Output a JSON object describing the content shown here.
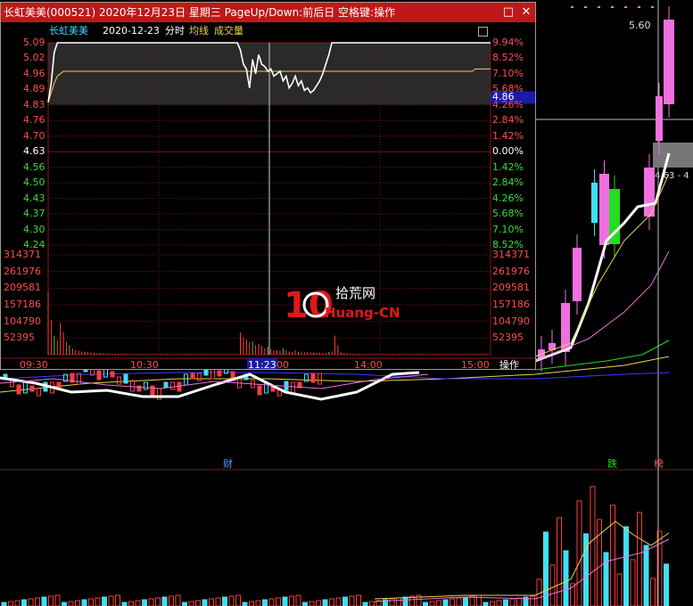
{
  "window": {
    "title": "长虹美美(000521) 2020年12月23日 星期三 PageUp/Down:前后日 空格键:操作",
    "btn_restore": "□",
    "btn_close": "✕"
  },
  "header": {
    "stock_name": "长虹美美",
    "date": "2020-12-23",
    "mode": "分时",
    "avg_label": "均线",
    "vol_label": "成交量",
    "settings_icon": "panel-icon"
  },
  "colors": {
    "up": "#ff3b3b",
    "down": "#3bd33b",
    "flat": "#ffffff",
    "avg": "#e8d64a",
    "price": "#ffffff",
    "title_bg": "#c01818",
    "grid": "#7a1212",
    "cyan": "#4fe3f0",
    "magenta": "#f07adf"
  },
  "price_axis": {
    "left": [
      "5.09",
      "5.02",
      "4.96",
      "4.89",
      "4.83",
      "4.76",
      "4.70",
      "4.63",
      "4.56",
      "4.50",
      "4.43",
      "4.37",
      "4.30",
      "4.24"
    ],
    "right": [
      "9.94%",
      "8.52%",
      "7.10%",
      "5.68%",
      "4.26%",
      "2.84%",
      "1.42%",
      "0.00%",
      "1.42%",
      "2.84%",
      "4.26%",
      "5.68%",
      "7.10%",
      "8.52%"
    ],
    "current_price": "4.86"
  },
  "volume_axis": [
    "314371",
    "261976",
    "209581",
    "157186",
    "104790",
    "52395"
  ],
  "time_axis": {
    "labels": [
      "09:30",
      "10:30",
      "00",
      "14:00",
      "15:00"
    ],
    "cursor_time": "11:23",
    "action_label": "操作"
  },
  "chart_data": {
    "type": "line",
    "x_range": [
      "09:30",
      "15:00"
    ],
    "ylim": [
      4.24,
      5.09
    ],
    "prev_close": 4.63,
    "series": [
      {
        "values": [
          4.84,
          4.92,
          5.05,
          5.09,
          5.09,
          5.09,
          5.09,
          5.09,
          5.09,
          5.09,
          5.09,
          5.09,
          5.09,
          5.09,
          5.09,
          5.09,
          5.09,
          5.09,
          5.09,
          5.09,
          5.09,
          5.09,
          5.09,
          5.09,
          5.09,
          5.09,
          5.09,
          5.09,
          5.09,
          5.09,
          5.09,
          5.09,
          5.09,
          5.09,
          5.09,
          5.09,
          5.09,
          5.09,
          5.09,
          5.09,
          5.09,
          5.09,
          5.09,
          5.09,
          5.09,
          5.09,
          5.09,
          5.09,
          5.09,
          5.09,
          5.09,
          5.09,
          5.09,
          5.09,
          5.09,
          5.09,
          5.09,
          5.09,
          5.09,
          5.09,
          5.09,
          5.09,
          5.09,
          5.06,
          5.0,
          4.98,
          4.9,
          5.02,
          4.96,
          5.04,
          5.0,
          4.99,
          4.97,
          4.98,
          4.95,
          4.96,
          4.97,
          4.93,
          4.95,
          4.9,
          4.92,
          4.95,
          4.91,
          4.93,
          4.89,
          4.9,
          4.88,
          4.89,
          4.91,
          4.93,
          4.96,
          5.0,
          5.04,
          5.09,
          5.09,
          5.09,
          5.09,
          5.09,
          5.09,
          5.09,
          5.09,
          5.09,
          5.09,
          5.09,
          5.09,
          5.09,
          5.09,
          5.09,
          5.09,
          5.09,
          5.09,
          5.09,
          5.09,
          5.09,
          5.09,
          5.09,
          5.09,
          5.09,
          5.09,
          5.09,
          5.09,
          5.09,
          5.09,
          5.09,
          5.09,
          5.09,
          5.09,
          5.09,
          5.09,
          5.09,
          5.09,
          5.09,
          5.09,
          5.09,
          5.09,
          5.09,
          5.09,
          5.09,
          5.09,
          5.09,
          5.09,
          5.09,
          5.09,
          5.09,
          5.09,
          5.09
        ]
      },
      {
        "values": [
          4.84,
          4.88,
          4.92,
          4.95,
          4.96,
          4.97,
          4.97,
          4.97,
          4.97,
          4.97,
          4.97,
          4.97,
          4.97,
          4.97,
          4.97,
          4.97,
          4.97,
          4.97,
          4.97,
          4.97,
          4.97,
          4.97,
          4.97,
          4.97,
          4.97,
          4.97,
          4.97,
          4.97,
          4.97,
          4.97,
          4.97,
          4.97,
          4.97,
          4.97,
          4.97,
          4.97,
          4.97,
          4.97,
          4.97,
          4.97,
          4.97,
          4.97,
          4.97,
          4.97,
          4.97,
          4.97,
          4.97,
          4.97,
          4.97,
          4.97,
          4.97,
          4.97,
          4.97,
          4.97,
          4.97,
          4.97,
          4.97,
          4.97,
          4.97,
          4.97,
          4.97,
          4.97,
          4.97,
          4.97,
          4.97,
          4.97,
          4.97,
          4.97,
          4.97,
          4.97,
          4.97,
          4.97,
          4.97,
          4.97,
          4.97,
          4.97,
          4.97,
          4.97,
          4.97,
          4.97,
          4.97,
          4.97,
          4.97,
          4.97,
          4.97,
          4.97,
          4.97,
          4.97,
          4.97,
          4.97,
          4.97,
          4.97,
          4.97,
          4.97,
          4.97,
          4.97,
          4.97,
          4.97,
          4.97,
          4.97,
          4.97,
          4.97,
          4.97,
          4.97,
          4.97,
          4.97,
          4.97,
          4.97,
          4.97,
          4.97,
          4.97,
          4.97,
          4.97,
          4.97,
          4.97,
          4.97,
          4.97,
          4.97,
          4.97,
          4.97,
          4.97,
          4.97,
          4.97,
          4.97,
          4.97,
          4.97,
          4.97,
          4.97,
          4.97,
          4.97,
          4.97,
          4.97,
          4.97,
          4.97,
          4.97,
          4.97,
          4.97,
          4.97,
          4.97,
          4.97,
          4.98,
          4.98,
          4.98,
          4.98,
          4.98,
          4.98
        ]
      }
    ],
    "volume_max": 314371,
    "volume": [
      200000,
      110000,
      60000,
      45000,
      100000,
      70000,
      40000,
      30000,
      20000,
      15000,
      12000,
      10000,
      9000,
      8000,
      7000,
      6000,
      5000,
      5000,
      4000,
      4000,
      3000,
      3000,
      3000,
      3000,
      3000,
      3000,
      2000,
      2000,
      2000,
      2000,
      2000,
      2000,
      2000,
      2000,
      2000,
      2000,
      2000,
      2000,
      2000,
      2000,
      2000,
      2000,
      2000,
      2000,
      2000,
      2000,
      2000,
      2000,
      2000,
      2000,
      2000,
      2000,
      2000,
      2000,
      2000,
      2000,
      2000,
      2000,
      2000,
      2000,
      2000,
      2000,
      2000,
      70000,
      55000,
      48000,
      40000,
      42000,
      30000,
      35000,
      28000,
      20000,
      26000,
      18000,
      15000,
      14000,
      12000,
      20000,
      15000,
      10000,
      9000,
      14000,
      8000,
      10000,
      7000,
      9000,
      8000,
      6000,
      7000,
      6000,
      5000,
      6000,
      8000,
      10000,
      60000,
      30000,
      8000,
      5000,
      4000,
      3000,
      3000,
      2000,
      2000,
      2000,
      2000,
      2000,
      2000,
      2000,
      2000,
      2000,
      2000,
      2000,
      2000,
      2000,
      2000,
      2000,
      2000,
      2000,
      2000,
      2000,
      2000,
      2000,
      2000,
      2000,
      2000,
      2000,
      2000,
      2000,
      2000,
      2000,
      2000,
      2000,
      2000,
      2000,
      2000,
      2000,
      2000,
      2000,
      2000,
      2000,
      2000,
      2000,
      2000,
      2000,
      2000
    ]
  },
  "background_chart": {
    "price_label_top": "5.60",
    "price_label_mid": "4.63 - 4",
    "markers": [
      "财",
      "跌",
      "榜"
    ]
  },
  "watermark": {
    "digits": "10",
    "chinese": "拾荒网",
    "latin": "Huang-CN"
  }
}
